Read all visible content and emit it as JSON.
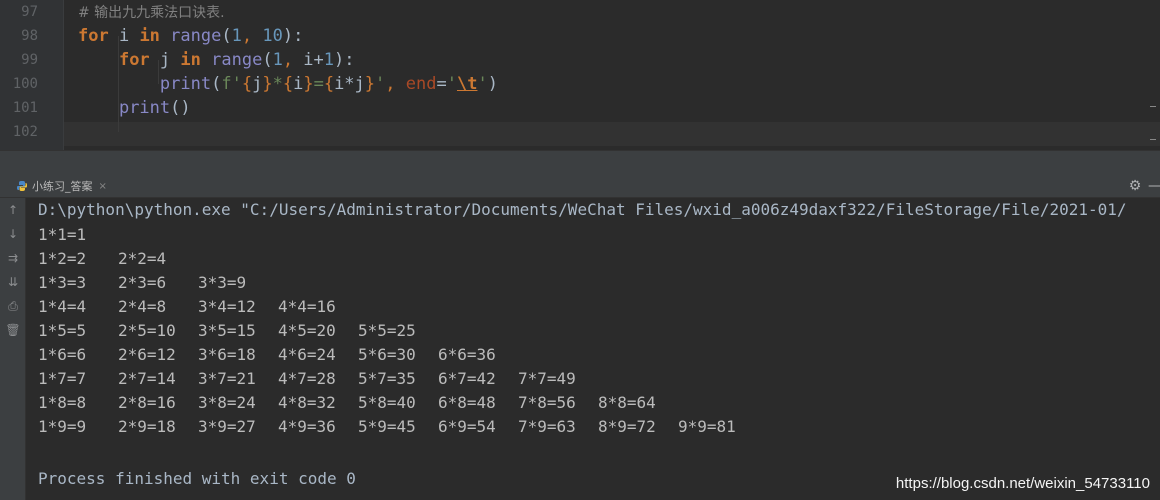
{
  "editor": {
    "lines": [
      {
        "number": "97",
        "tokens": [
          {
            "t": "# 输出九九乘法口诀表.",
            "c": "cm"
          }
        ]
      },
      {
        "number": "98",
        "tokens": [
          {
            "t": "for",
            "c": "kw"
          },
          {
            "t": " i ",
            "c": ""
          },
          {
            "t": "in",
            "c": "kw"
          },
          {
            "t": " ",
            "c": ""
          },
          {
            "t": "range",
            "c": "bi"
          },
          {
            "t": "(",
            "c": ""
          },
          {
            "t": "1",
            "c": "num"
          },
          {
            "t": ", ",
            "c": "fv"
          },
          {
            "t": "10",
            "c": "num"
          },
          {
            "t": "):",
            "c": ""
          }
        ]
      },
      {
        "number": "99",
        "tokens": [
          {
            "t": "    ",
            "c": ""
          },
          {
            "t": "for",
            "c": "kw"
          },
          {
            "t": " j ",
            "c": ""
          },
          {
            "t": "in",
            "c": "kw"
          },
          {
            "t": " ",
            "c": ""
          },
          {
            "t": "range",
            "c": "bi"
          },
          {
            "t": "(",
            "c": ""
          },
          {
            "t": "1",
            "c": "num"
          },
          {
            "t": ", ",
            "c": "fv"
          },
          {
            "t": "i+",
            "c": ""
          },
          {
            "t": "1",
            "c": "num"
          },
          {
            "t": "):",
            "c": ""
          }
        ]
      },
      {
        "number": "100",
        "tokens": [
          {
            "t": "        ",
            "c": ""
          },
          {
            "t": "print",
            "c": "bi"
          },
          {
            "t": "(",
            "c": ""
          },
          {
            "t": "f'",
            "c": "str"
          },
          {
            "t": "{",
            "c": "fv"
          },
          {
            "t": "j",
            "c": ""
          },
          {
            "t": "}",
            "c": "fv"
          },
          {
            "t": "*",
            "c": "str"
          },
          {
            "t": "{",
            "c": "fv"
          },
          {
            "t": "i",
            "c": ""
          },
          {
            "t": "}",
            "c": "fv"
          },
          {
            "t": "=",
            "c": "str"
          },
          {
            "t": "{",
            "c": "fv"
          },
          {
            "t": "i*j",
            "c": ""
          },
          {
            "t": "}",
            "c": "fv"
          },
          {
            "t": "'",
            "c": "str"
          },
          {
            "t": ", ",
            "c": "fv"
          },
          {
            "t": "end",
            "c": "kwarg"
          },
          {
            "t": "=",
            "c": ""
          },
          {
            "t": "'",
            "c": "str"
          },
          {
            "t": "\\t",
            "c": "esc"
          },
          {
            "t": "'",
            "c": "str"
          },
          {
            "t": ")",
            "c": ""
          }
        ]
      },
      {
        "number": "101",
        "tokens": [
          {
            "t": "    ",
            "c": ""
          },
          {
            "t": "print",
            "c": "bi"
          },
          {
            "t": "()",
            "c": ""
          }
        ]
      },
      {
        "number": "102",
        "tokens": []
      }
    ]
  },
  "run": {
    "tab_label": "小练习_答案",
    "tab_icon": "python-file-icon",
    "settings_icon": "⚙",
    "minimize_icon": "—",
    "side_icons": [
      {
        "name": "rerun-up-icon",
        "glyph": "↑"
      },
      {
        "name": "scroll-down-icon",
        "glyph": "↓"
      },
      {
        "name": "soft-wrap-icon",
        "glyph": "⇉"
      },
      {
        "name": "scroll-to-end-icon",
        "glyph": "⇊"
      },
      {
        "name": "print-icon",
        "glyph": "⎙"
      },
      {
        "name": "trash-icon",
        "glyph": "🗑"
      }
    ]
  },
  "console": {
    "command": "D:\\python\\python.exe \"C:/Users/Administrator/Documents/WeChat Files/wxid_a006z49daxf322/FileStorage/File/2021-01/",
    "output_lines": [
      "1*1=1",
      "1*2=2\t2*2=4",
      "1*3=3\t2*3=6\t3*3=9",
      "1*4=4\t2*4=8\t3*4=12\t4*4=16",
      "1*5=5\t2*5=10\t3*5=15\t4*5=20\t5*5=25",
      "1*6=6\t2*6=12\t3*6=18\t4*6=24\t5*6=30\t6*6=36",
      "1*7=7\t2*7=14\t3*7=21\t4*7=28\t5*7=35\t6*7=42\t7*7=49",
      "1*8=8\t2*8=16\t3*8=24\t4*8=32\t5*8=40\t6*8=48\t7*8=56\t8*8=64",
      "1*9=9\t2*9=18\t3*9=27\t4*9=36\t5*9=45\t6*9=54\t7*9=63\t8*9=72\t9*9=81"
    ],
    "exit_message": "Process finished with exit code 0"
  },
  "watermark": "https://blog.csdn.net/weixin_54733110",
  "colors": {
    "keyword": "#cc7832",
    "number": "#6897bb",
    "builtin": "#8888c6",
    "string": "#6a8759",
    "comment": "#808080",
    "background": "#2b2b2b",
    "panel": "#3c3f41"
  }
}
